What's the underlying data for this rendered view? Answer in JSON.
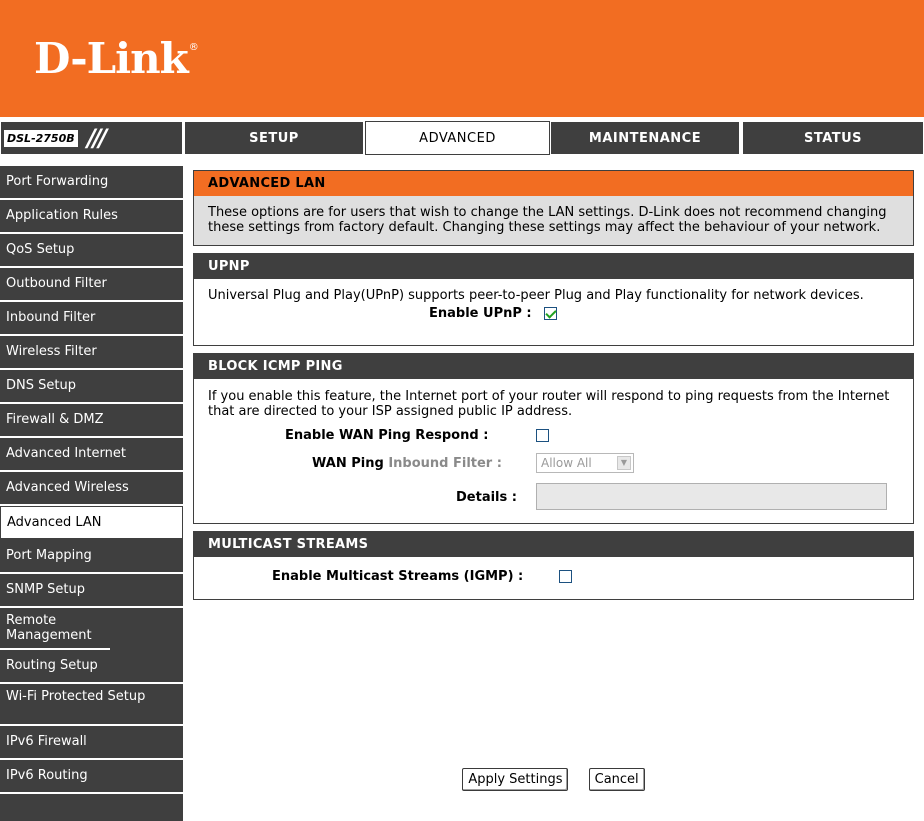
{
  "header": {
    "logo": "D-Link",
    "registered": "®"
  },
  "model": {
    "label": "DSL-2750B",
    "slashes": "///"
  },
  "tabs": [
    {
      "label": "SETUP"
    },
    {
      "label": "ADVANCED"
    },
    {
      "label": "MAINTENANCE"
    },
    {
      "label": "STATUS"
    }
  ],
  "sidebar": {
    "items": [
      {
        "label": "Port Forwarding"
      },
      {
        "label": "Application Rules"
      },
      {
        "label": "QoS Setup"
      },
      {
        "label": "Outbound Filter"
      },
      {
        "label": "Inbound Filter"
      },
      {
        "label": "Wireless Filter"
      },
      {
        "label": "DNS Setup"
      },
      {
        "label": "Firewall & DMZ"
      },
      {
        "label": "Advanced Internet"
      },
      {
        "label": "Advanced Wireless"
      },
      {
        "label": "Advanced LAN"
      },
      {
        "label": "Port Mapping"
      },
      {
        "label": "SNMP Setup"
      },
      {
        "label": "Remote Management"
      },
      {
        "label": "Routing Setup"
      },
      {
        "label": "Wi-Fi Protected Setup"
      },
      {
        "label": "IPv6 Firewall"
      },
      {
        "label": "IPv6 Routing"
      }
    ]
  },
  "advanced_lan": {
    "title": "ADVANCED LAN",
    "description": "These options are for users that wish to change the LAN settings. D-Link does not recommend changing these settings from factory default. Changing these settings may affect the behaviour of your network."
  },
  "upnp": {
    "title": "UPNP",
    "description": "Universal Plug and Play(UPnP) supports peer-to-peer Plug and Play functionality for network devices.",
    "enable_label": "Enable UPnP :",
    "enabled": true
  },
  "block_icmp": {
    "title": "BLOCK ICMP PING",
    "description": "If you enable this feature, the Internet port of your router will respond to ping requests from the Internet that are directed to your ISP assigned public IP address.",
    "enable_label": "Enable WAN Ping Respond :",
    "enabled": false,
    "filter_label_bold": "WAN Ping",
    "filter_label_grey": "Inbound Filter :",
    "filter_value": "Allow All",
    "details_label": "Details :",
    "details_value": ""
  },
  "multicast": {
    "title": "MULTICAST STREAMS",
    "enable_label": "Enable Multicast Streams (IGMP) :",
    "enabled": false
  },
  "buttons": {
    "apply": "Apply Settings",
    "cancel": "Cancel"
  }
}
